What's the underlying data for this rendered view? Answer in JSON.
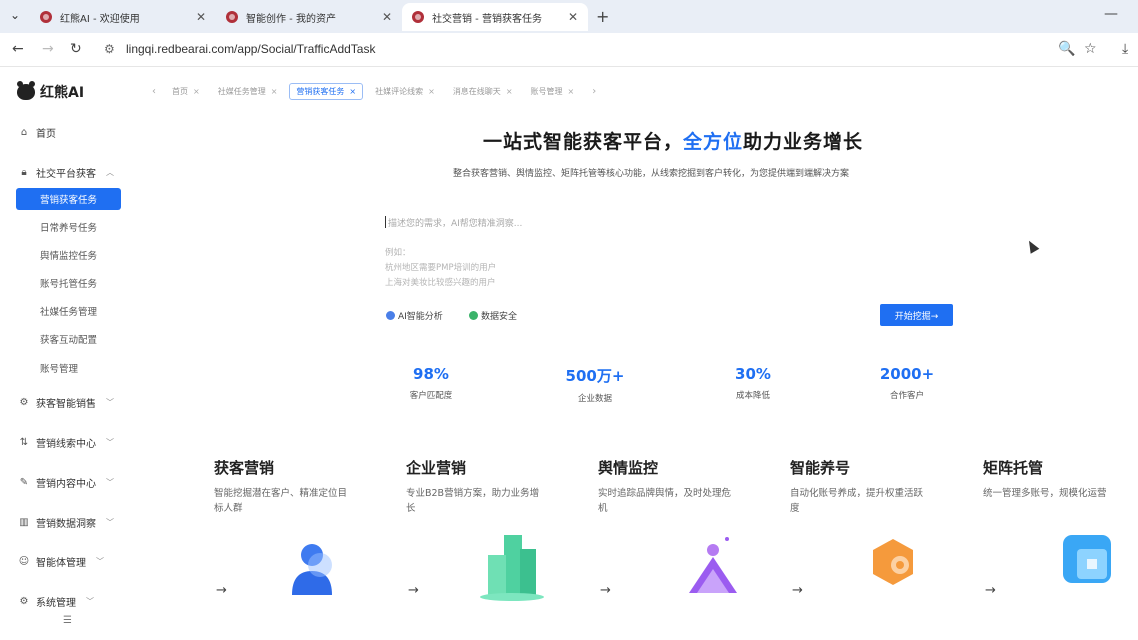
{
  "browser": {
    "tabs": [
      {
        "title": "红熊AI - 欢迎使用"
      },
      {
        "title": "智能创作 - 我的资产"
      },
      {
        "title": "社交营销 - 营销获客任务"
      }
    ],
    "url": "lingqi.redbearai.com/app/Social/TrafficAddTask"
  },
  "brand": {
    "name": "红熊AI"
  },
  "sidebar": {
    "items": [
      {
        "label": "首页",
        "icon": "home-icon"
      },
      {
        "label": "社交平台获客",
        "icon": "lock-icon"
      },
      {
        "label": "获客智能销售",
        "icon": "settings-icon"
      },
      {
        "label": "营销线索中心",
        "icon": "transfer-icon"
      },
      {
        "label": "营销内容中心",
        "icon": "edit-icon"
      },
      {
        "label": "营销数据洞察",
        "icon": "bar-chart-icon"
      },
      {
        "label": "智能体管理",
        "icon": "robot-icon"
      },
      {
        "label": "系统管理",
        "icon": "gear-icon"
      }
    ],
    "subitems": [
      "营销获客任务",
      "日常养号任务",
      "舆情监控任务",
      "账号托管任务",
      "社媒任务管理",
      "获客互动配置",
      "账号管理"
    ]
  },
  "page_tabs": [
    "首页",
    "社媒任务管理",
    "营销获客任务",
    "社媒评论线索",
    "消息在线聊天",
    "账号管理"
  ],
  "hero": {
    "title_pre": "一站式智能获客平台，",
    "title_hl": "全方位",
    "title_post": "助力业务增长",
    "subtitle": "整合获客营销、舆情监控、矩阵托管等核心功能，从线索挖掘到客户转化，为您提供端到端解决方案"
  },
  "search": {
    "placeholder": "描述您的需求，AI帮您精准洞察...",
    "example_label": "例如：",
    "example1": "杭州地区需要PMP培训的用户",
    "example2": "上海对美妆比较感兴趣的用户",
    "feature_ai": "AI智能分析",
    "feature_security": "数据安全",
    "start_button": "开始挖掘→"
  },
  "stats": [
    {
      "value": "98%",
      "label": "客户匹配度"
    },
    {
      "value": "500万+",
      "label": "企业数据"
    },
    {
      "value": "30%",
      "label": "成本降低"
    },
    {
      "value": "2000+",
      "label": "合作客户"
    }
  ],
  "cards": [
    {
      "title": "获客营销",
      "desc": "智能挖掘潜在客户、精准定位目标人群",
      "arrow": "→"
    },
    {
      "title": "企业营销",
      "desc": "专业B2B营销方案，助力业务增长",
      "arrow": "→"
    },
    {
      "title": "舆情监控",
      "desc": "实时追踪品牌舆情，及时处理危机",
      "arrow": "→"
    },
    {
      "title": "智能养号",
      "desc": "自动化账号养成，提升权重活跃度",
      "arrow": "→"
    },
    {
      "title": "矩阵托管",
      "desc": "统一管理多账号，规模化运营",
      "arrow": "→"
    }
  ],
  "colors": {
    "accent": "#1f6ff2",
    "active_bg": "#1f6ff2"
  }
}
